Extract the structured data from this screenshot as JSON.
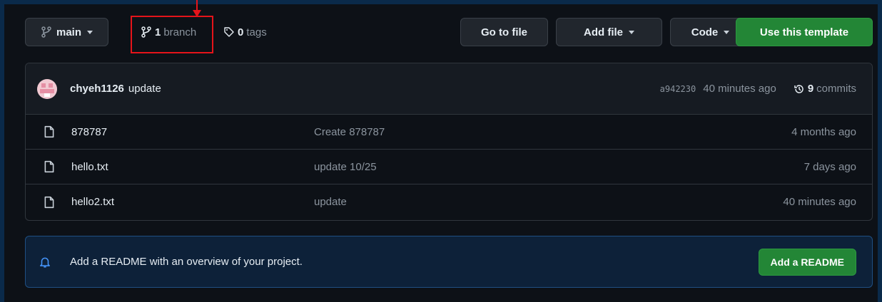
{
  "toolbar": {
    "branch_label": "main",
    "branches": {
      "count": "1",
      "label": "branch"
    },
    "tags": {
      "count": "0",
      "label": "tags"
    },
    "go_to_file": "Go to file",
    "add_file": "Add file",
    "code": "Code",
    "use_template": "Use this template"
  },
  "latest_commit": {
    "author": "chyeh1126",
    "message": "update",
    "sha": "a942230",
    "time": "40 minutes ago",
    "commit_count": "9",
    "commits_label": "commits"
  },
  "files": [
    {
      "name": "878787",
      "message": "Create 878787",
      "age": "4 months ago"
    },
    {
      "name": "hello.txt",
      "message": "update 10/25",
      "age": "7 days ago"
    },
    {
      "name": "hello2.txt",
      "message": "update",
      "age": "40 minutes ago"
    }
  ],
  "readme_banner": {
    "text": "Add a README with an overview of your project.",
    "button": "Add a README"
  },
  "colors": {
    "primary_green": "#238636",
    "annotation_red": "#e5141a",
    "banner_bg": "#0d2139"
  }
}
